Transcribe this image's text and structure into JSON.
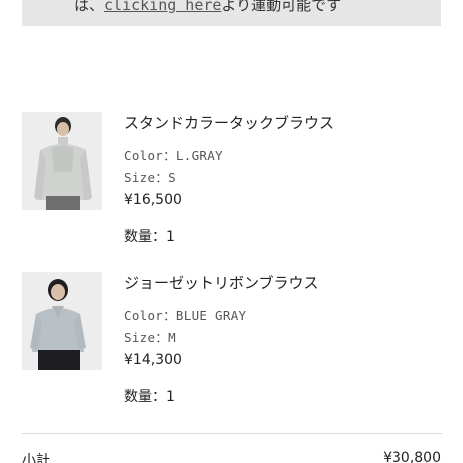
{
  "notice": {
    "prefix": "は、",
    "link": "clicking here",
    "suffix": "より運動可能です"
  },
  "items": [
    {
      "name": "スタンドカラータックブラウス",
      "color": "Color：L.GRAY",
      "size": "Size：S",
      "price": "¥16,500",
      "quantity": "数量：1"
    },
    {
      "name": "ジョーゼットリボンブラウス",
      "color": "Color：BLUE GRAY",
      "size": "Size：M",
      "price": "¥14,300",
      "quantity": "数量：1"
    }
  ],
  "summary": {
    "subtotal_label": "小計",
    "subtotal_value": "¥30,800"
  },
  "colors": {
    "notice_bg": "#e6e6e6",
    "divider": "#dcdcdc"
  }
}
